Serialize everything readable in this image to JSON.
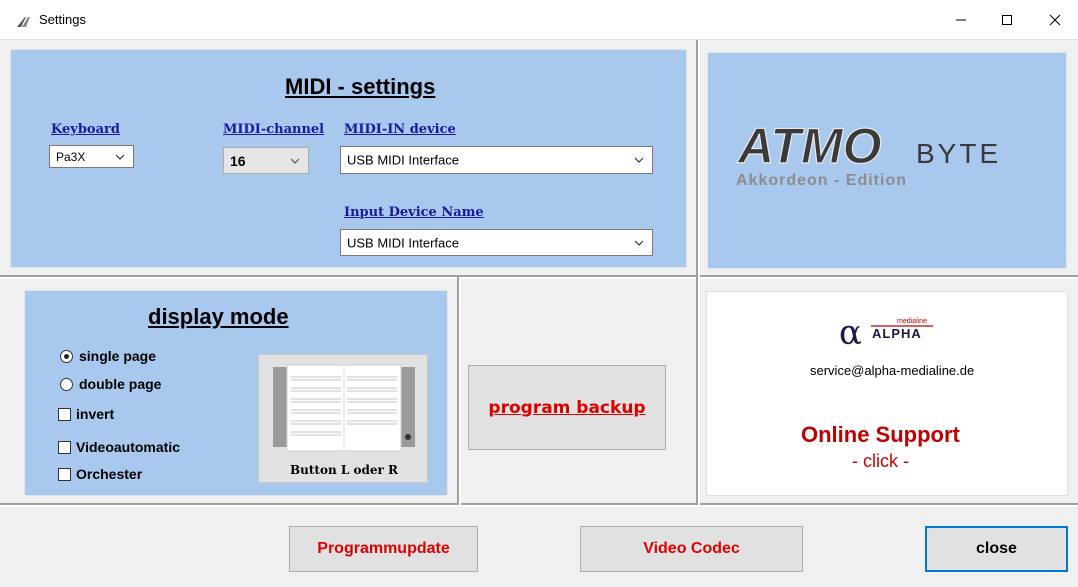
{
  "window": {
    "title": "Settings",
    "minimize_label": "–",
    "maximize_label": "☐",
    "close_label": "✕"
  },
  "midi": {
    "heading": "MIDI - settings",
    "keyboard": {
      "label": "Keyboard",
      "value": "Pa3X"
    },
    "channel": {
      "label": "MIDI-channel",
      "value": "16"
    },
    "in_device": {
      "label": "MIDI-IN device",
      "value": "USB MIDI Interface"
    },
    "input_device_name": {
      "label": "Input Device Name",
      "value": "USB MIDI Interface"
    }
  },
  "logo": {
    "atmo_main": "ATMO",
    "atmo_byte": "BYTE",
    "atmo_edition": "Akkordeon - Edition"
  },
  "display_mode": {
    "heading": "display mode",
    "options": [
      {
        "label": "single page",
        "selected": true
      },
      {
        "label": "double page",
        "selected": false
      }
    ],
    "checks": [
      {
        "label": "invert",
        "checked": false
      },
      {
        "label": "Videoautomatic",
        "checked": false
      },
      {
        "label": "Orchester",
        "checked": false
      }
    ],
    "preview_caption": "Button  L oder R"
  },
  "backup": {
    "label": "program backup"
  },
  "support": {
    "alpha_brand": "ALPHA",
    "alpha_small": "medialine",
    "email": "service@alpha-medialine.de",
    "online": "Online Support",
    "click": "- click -"
  },
  "footer": {
    "programmupdate": "Programmupdate",
    "video_codec": "Video Codec",
    "close": "close"
  },
  "colors": {
    "panel_blue": "#a8c8ee",
    "accent_red": "#e00000",
    "link_blue": "#1a1aa0",
    "focus_blue": "#0078d7"
  }
}
